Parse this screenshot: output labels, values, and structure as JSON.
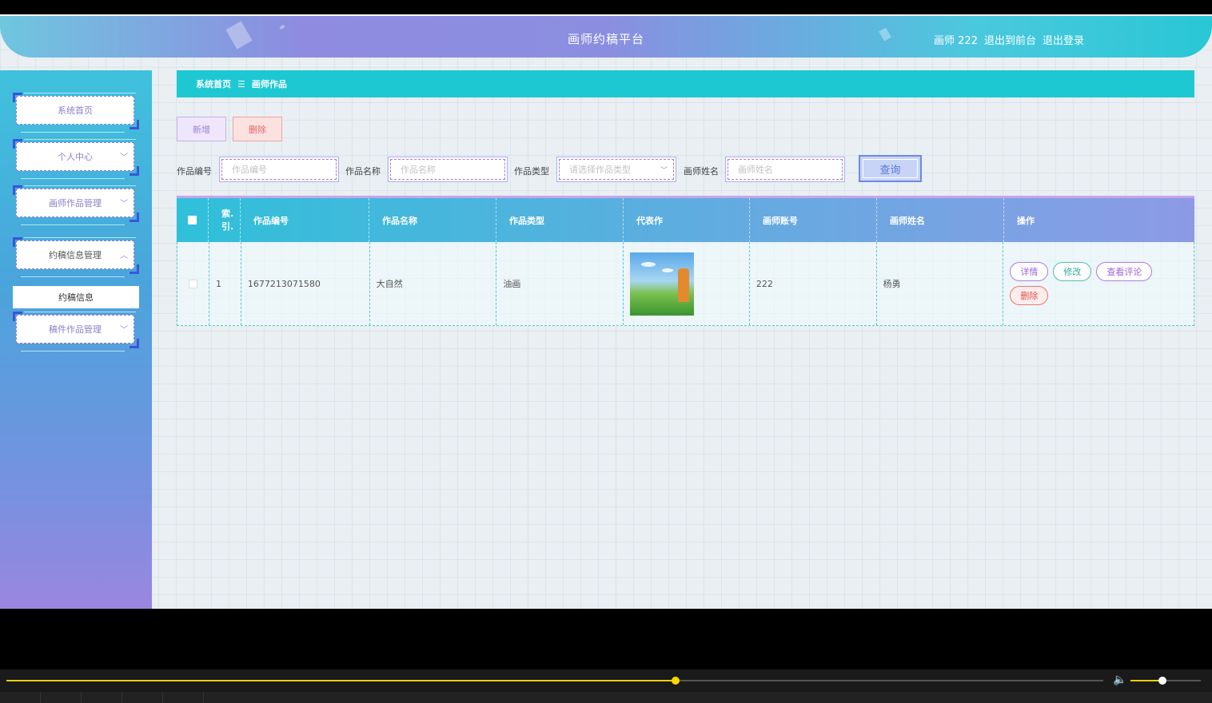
{
  "header": {
    "title": "画师约稿平台",
    "user": "画师 222",
    "to_front": "退出到前台",
    "logout": "退出登录"
  },
  "sidebar": {
    "items": [
      {
        "label": "系统首页",
        "has_arrow": false
      },
      {
        "label": "个人中心",
        "has_arrow": true
      },
      {
        "label": "画师作品管理",
        "has_arrow": true
      },
      {
        "label": "约稿信息管理",
        "has_arrow": true,
        "open": true
      },
      {
        "label": "稿件作品管理",
        "has_arrow": true
      }
    ],
    "submenu": "约稿信息"
  },
  "breadcrumb": {
    "home": "系统首页",
    "separator": "☰",
    "current": "画师作品"
  },
  "toolbar": {
    "add_label": "新增",
    "delete_label": "删除"
  },
  "search": {
    "work_no_label": "作品编号",
    "work_no_placeholder": "作品编号",
    "work_name_label": "作品名称",
    "work_name_placeholder": "作品名称",
    "work_type_label": "作品类型",
    "work_type_placeholder": "请选择作品类型",
    "artist_name_label": "画师姓名",
    "artist_name_placeholder": "画师姓名",
    "query_label": "查询"
  },
  "table": {
    "headers": [
      "索引",
      "作品编号",
      "作品名称",
      "作品类型",
      "代表作",
      "画师账号",
      "画师姓名",
      "操作"
    ],
    "index_header_line1": "索.",
    "index_header_line2": "引.",
    "rows": [
      {
        "index": "1",
        "work_no": "1677213071580",
        "work_name": "大自然",
        "work_type": "油画",
        "account": "222",
        "artist": "杨勇"
      }
    ],
    "actions": {
      "detail": "详情",
      "edit": "修改",
      "review": "查看评论",
      "delete": "删除"
    }
  },
  "player": {
    "progress": 0.61,
    "volume": 0.45,
    "volume_icon": "speaker-icon"
  },
  "colors": {
    "accent": "#1ec8d2",
    "purple": "#8e8be0",
    "progress": "#f0d000"
  }
}
